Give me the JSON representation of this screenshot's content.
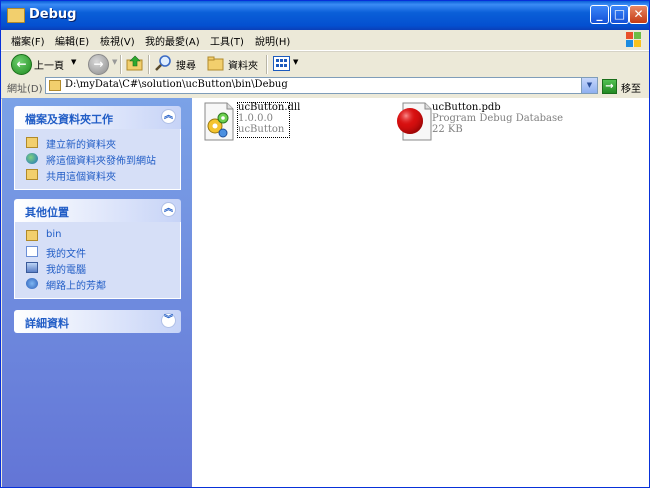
{
  "window": {
    "title": "Debug",
    "min_label": "_",
    "max_label": "□",
    "close_label": "✕"
  },
  "menu": {
    "items": [
      "檔案(F)",
      "編輯(E)",
      "檢視(V)",
      "我的最愛(A)",
      "工具(T)",
      "說明(H)"
    ]
  },
  "toolbar": {
    "back_label": "上一頁",
    "back_icon": "←",
    "fwd_icon": "→",
    "search_label": "搜尋",
    "folders_label": "資料夾"
  },
  "address": {
    "label": "網址(D)",
    "path": "D:\\myData\\C#\\solution\\ucButton\\bin\\Debug",
    "go_label": "移至",
    "go_icon": "→"
  },
  "tasks": {
    "file_folder_tasks": {
      "title": "檔案及資料夾工作",
      "items": [
        "建立新的資料夾",
        "將這個資料夾發佈到網站",
        "共用這個資料夾"
      ]
    },
    "other_places": {
      "title": "其他位置",
      "items": [
        "bin",
        "我的文件",
        "我的電腦",
        "網路上的芳鄰"
      ]
    },
    "details": {
      "title": "詳細資料"
    }
  },
  "files": [
    {
      "name": "ucButton.dll",
      "line2": "1.0.0.0",
      "line3": "ucButton",
      "icon": "dll-gear-icon"
    },
    {
      "name": "ucButton.pdb",
      "line2": "Program Debug Database",
      "line3": "22 KB",
      "icon": "pdb-red-ball-icon"
    }
  ],
  "colors": {
    "titlebar": "#0a5fd8",
    "taskpane": "#6f8fdf",
    "link": "#215dc6"
  }
}
